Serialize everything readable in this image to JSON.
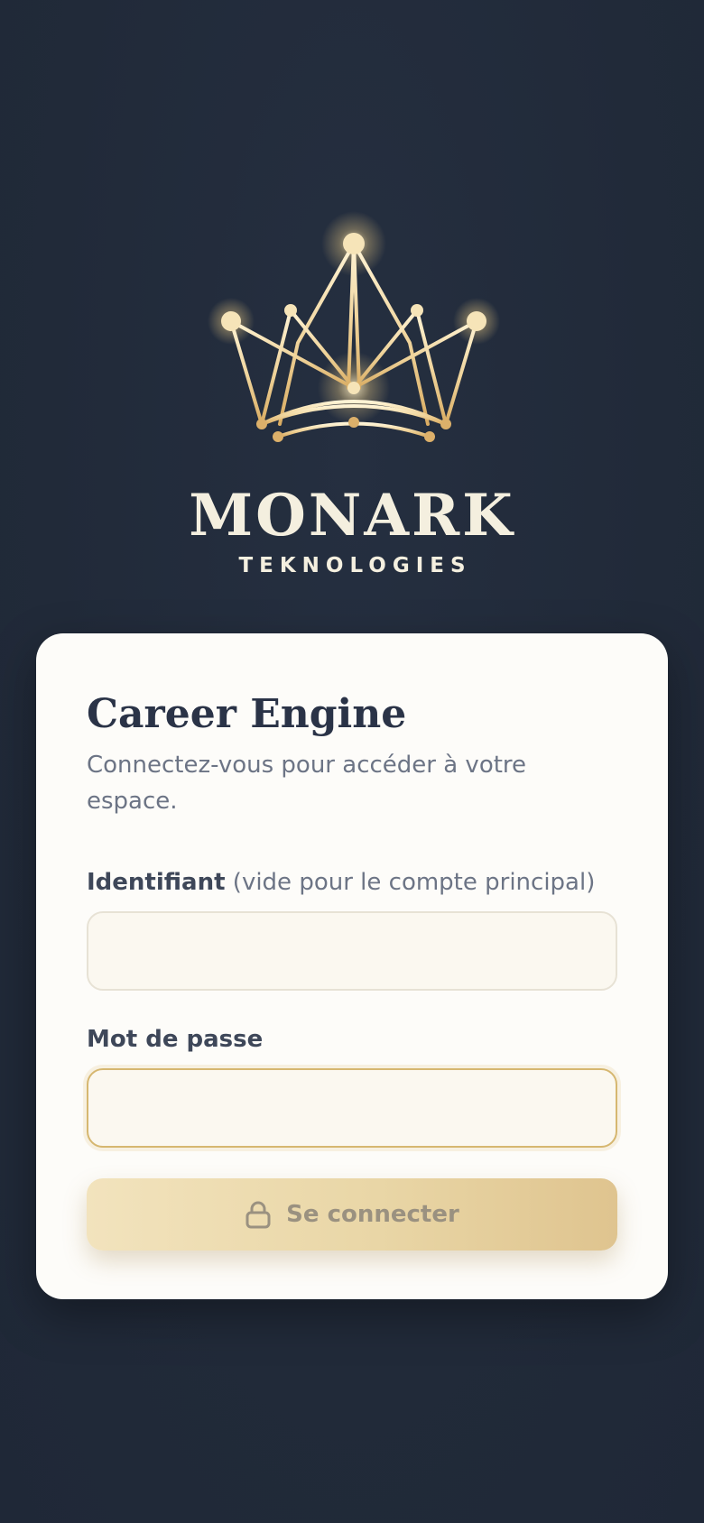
{
  "brand": {
    "name": "MONARK",
    "tagline": "TEKNOLOGIES"
  },
  "login": {
    "title": "Career Engine",
    "subtitle": "Connectez-vous pour accéder à votre espace.",
    "identifier": {
      "label": "Identifiant",
      "hint": "(vide pour le compte principal)",
      "value": ""
    },
    "password": {
      "label": "Mot de passe",
      "value": ""
    },
    "submit": {
      "label": "Se connecter",
      "icon": "lock-icon"
    }
  },
  "colors": {
    "background": "#222b3b",
    "card": "#fdfcf9",
    "gold": "#e6c98c",
    "title": "#2a3347"
  }
}
